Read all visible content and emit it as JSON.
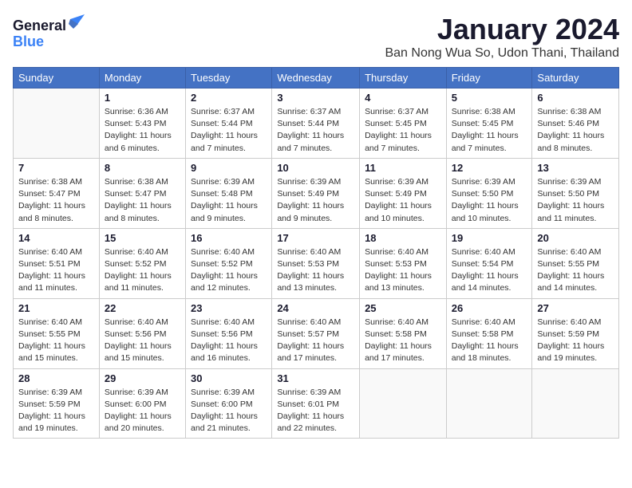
{
  "logo": {
    "line1": "General",
    "line2": "Blue"
  },
  "title": "January 2024",
  "subtitle": "Ban Nong Wua So, Udon Thani, Thailand",
  "days_of_week": [
    "Sunday",
    "Monday",
    "Tuesday",
    "Wednesday",
    "Thursday",
    "Friday",
    "Saturday"
  ],
  "weeks": [
    [
      {
        "day": "",
        "sunrise": "",
        "sunset": "",
        "daylight": ""
      },
      {
        "day": "1",
        "sunrise": "Sunrise: 6:36 AM",
        "sunset": "Sunset: 5:43 PM",
        "daylight": "Daylight: 11 hours and 6 minutes."
      },
      {
        "day": "2",
        "sunrise": "Sunrise: 6:37 AM",
        "sunset": "Sunset: 5:44 PM",
        "daylight": "Daylight: 11 hours and 7 minutes."
      },
      {
        "day": "3",
        "sunrise": "Sunrise: 6:37 AM",
        "sunset": "Sunset: 5:44 PM",
        "daylight": "Daylight: 11 hours and 7 minutes."
      },
      {
        "day": "4",
        "sunrise": "Sunrise: 6:37 AM",
        "sunset": "Sunset: 5:45 PM",
        "daylight": "Daylight: 11 hours and 7 minutes."
      },
      {
        "day": "5",
        "sunrise": "Sunrise: 6:38 AM",
        "sunset": "Sunset: 5:45 PM",
        "daylight": "Daylight: 11 hours and 7 minutes."
      },
      {
        "day": "6",
        "sunrise": "Sunrise: 6:38 AM",
        "sunset": "Sunset: 5:46 PM",
        "daylight": "Daylight: 11 hours and 8 minutes."
      }
    ],
    [
      {
        "day": "7",
        "sunrise": "Sunrise: 6:38 AM",
        "sunset": "Sunset: 5:47 PM",
        "daylight": "Daylight: 11 hours and 8 minutes."
      },
      {
        "day": "8",
        "sunrise": "Sunrise: 6:38 AM",
        "sunset": "Sunset: 5:47 PM",
        "daylight": "Daylight: 11 hours and 8 minutes."
      },
      {
        "day": "9",
        "sunrise": "Sunrise: 6:39 AM",
        "sunset": "Sunset: 5:48 PM",
        "daylight": "Daylight: 11 hours and 9 minutes."
      },
      {
        "day": "10",
        "sunrise": "Sunrise: 6:39 AM",
        "sunset": "Sunset: 5:49 PM",
        "daylight": "Daylight: 11 hours and 9 minutes."
      },
      {
        "day": "11",
        "sunrise": "Sunrise: 6:39 AM",
        "sunset": "Sunset: 5:49 PM",
        "daylight": "Daylight: 11 hours and 10 minutes."
      },
      {
        "day": "12",
        "sunrise": "Sunrise: 6:39 AM",
        "sunset": "Sunset: 5:50 PM",
        "daylight": "Daylight: 11 hours and 10 minutes."
      },
      {
        "day": "13",
        "sunrise": "Sunrise: 6:39 AM",
        "sunset": "Sunset: 5:50 PM",
        "daylight": "Daylight: 11 hours and 11 minutes."
      }
    ],
    [
      {
        "day": "14",
        "sunrise": "Sunrise: 6:40 AM",
        "sunset": "Sunset: 5:51 PM",
        "daylight": "Daylight: 11 hours and 11 minutes."
      },
      {
        "day": "15",
        "sunrise": "Sunrise: 6:40 AM",
        "sunset": "Sunset: 5:52 PM",
        "daylight": "Daylight: 11 hours and 11 minutes."
      },
      {
        "day": "16",
        "sunrise": "Sunrise: 6:40 AM",
        "sunset": "Sunset: 5:52 PM",
        "daylight": "Daylight: 11 hours and 12 minutes."
      },
      {
        "day": "17",
        "sunrise": "Sunrise: 6:40 AM",
        "sunset": "Sunset: 5:53 PM",
        "daylight": "Daylight: 11 hours and 13 minutes."
      },
      {
        "day": "18",
        "sunrise": "Sunrise: 6:40 AM",
        "sunset": "Sunset: 5:53 PM",
        "daylight": "Daylight: 11 hours and 13 minutes."
      },
      {
        "day": "19",
        "sunrise": "Sunrise: 6:40 AM",
        "sunset": "Sunset: 5:54 PM",
        "daylight": "Daylight: 11 hours and 14 minutes."
      },
      {
        "day": "20",
        "sunrise": "Sunrise: 6:40 AM",
        "sunset": "Sunset: 5:55 PM",
        "daylight": "Daylight: 11 hours and 14 minutes."
      }
    ],
    [
      {
        "day": "21",
        "sunrise": "Sunrise: 6:40 AM",
        "sunset": "Sunset: 5:55 PM",
        "daylight": "Daylight: 11 hours and 15 minutes."
      },
      {
        "day": "22",
        "sunrise": "Sunrise: 6:40 AM",
        "sunset": "Sunset: 5:56 PM",
        "daylight": "Daylight: 11 hours and 15 minutes."
      },
      {
        "day": "23",
        "sunrise": "Sunrise: 6:40 AM",
        "sunset": "Sunset: 5:56 PM",
        "daylight": "Daylight: 11 hours and 16 minutes."
      },
      {
        "day": "24",
        "sunrise": "Sunrise: 6:40 AM",
        "sunset": "Sunset: 5:57 PM",
        "daylight": "Daylight: 11 hours and 17 minutes."
      },
      {
        "day": "25",
        "sunrise": "Sunrise: 6:40 AM",
        "sunset": "Sunset: 5:58 PM",
        "daylight": "Daylight: 11 hours and 17 minutes."
      },
      {
        "day": "26",
        "sunrise": "Sunrise: 6:40 AM",
        "sunset": "Sunset: 5:58 PM",
        "daylight": "Daylight: 11 hours and 18 minutes."
      },
      {
        "day": "27",
        "sunrise": "Sunrise: 6:40 AM",
        "sunset": "Sunset: 5:59 PM",
        "daylight": "Daylight: 11 hours and 19 minutes."
      }
    ],
    [
      {
        "day": "28",
        "sunrise": "Sunrise: 6:39 AM",
        "sunset": "Sunset: 5:59 PM",
        "daylight": "Daylight: 11 hours and 19 minutes."
      },
      {
        "day": "29",
        "sunrise": "Sunrise: 6:39 AM",
        "sunset": "Sunset: 6:00 PM",
        "daylight": "Daylight: 11 hours and 20 minutes."
      },
      {
        "day": "30",
        "sunrise": "Sunrise: 6:39 AM",
        "sunset": "Sunset: 6:00 PM",
        "daylight": "Daylight: 11 hours and 21 minutes."
      },
      {
        "day": "31",
        "sunrise": "Sunrise: 6:39 AM",
        "sunset": "Sunset: 6:01 PM",
        "daylight": "Daylight: 11 hours and 22 minutes."
      },
      {
        "day": "",
        "sunrise": "",
        "sunset": "",
        "daylight": ""
      },
      {
        "day": "",
        "sunrise": "",
        "sunset": "",
        "daylight": ""
      },
      {
        "day": "",
        "sunrise": "",
        "sunset": "",
        "daylight": ""
      }
    ]
  ]
}
